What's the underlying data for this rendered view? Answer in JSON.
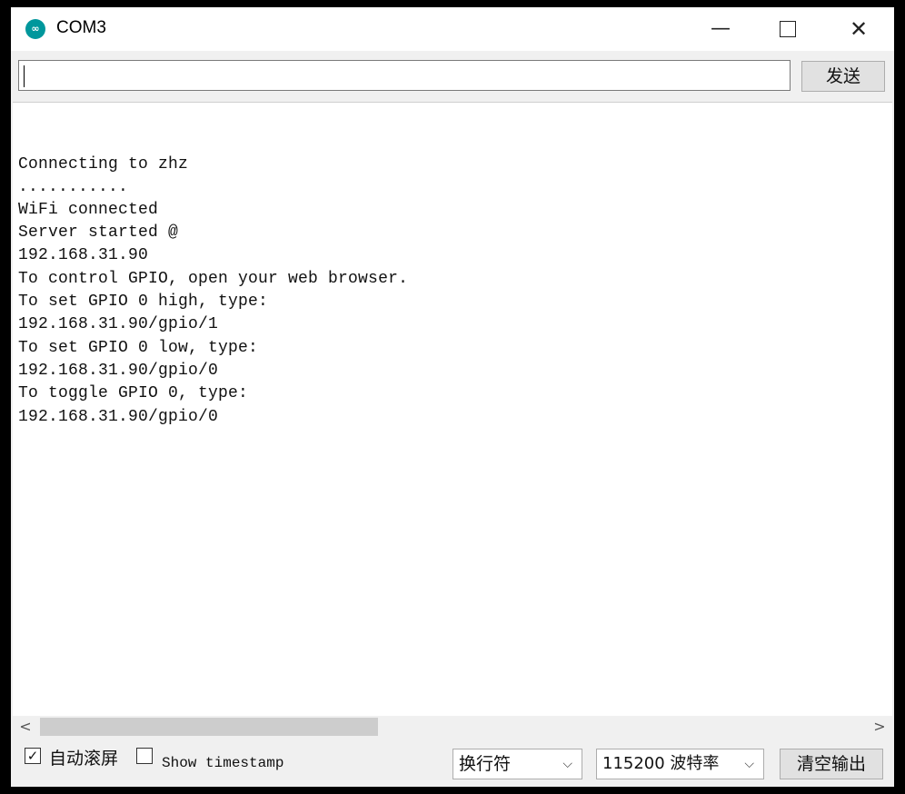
{
  "window": {
    "title": "COM3",
    "icon": "arduino-icon",
    "icon_glyph": "∞",
    "minimize_glyph": "—",
    "close_glyph": "✕"
  },
  "send": {
    "input_value": "",
    "button_label": "发送"
  },
  "output": {
    "lines": [
      "Connecting to zhz",
      "...........",
      "WiFi connected",
      "Server started @",
      "192.168.31.90",
      "To control GPIO, open your web browser.",
      "To set GPIO 0 high, type:",
      "192.168.31.90/gpio/1",
      "To set GPIO 0 low, type:",
      "192.168.31.90/gpio/0",
      "To toggle GPIO 0, type:",
      "192.168.31.90/gpio/0"
    ]
  },
  "scrollbar": {
    "left_arrow": "<",
    "right_arrow": ">"
  },
  "footer": {
    "autoscroll_label": "自动滚屏",
    "autoscroll_checked": "✓",
    "timestamp_label": "Show timestamp",
    "line_ending_value": "换行符",
    "baud_value": "115200 波特率",
    "chevron": "⌵",
    "clear_label": "清空输出"
  }
}
